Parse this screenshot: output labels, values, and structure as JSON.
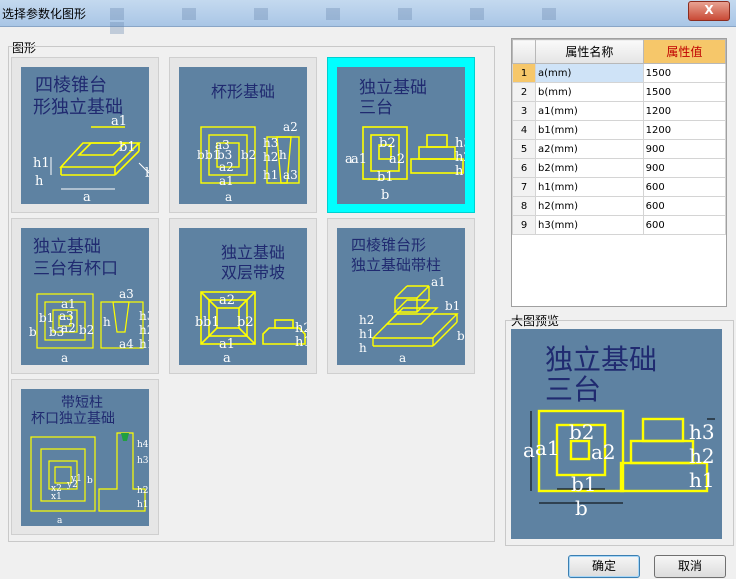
{
  "window": {
    "title": "选择参数化图形",
    "close_label": "X"
  },
  "shapes_group": {
    "label": "图形",
    "tiles": [
      {
        "name": "四棱锥台形独立基础",
        "lines": [
          "四棱锥台",
          "形独立基础"
        ],
        "selected": false
      },
      {
        "name": "杯形基础",
        "lines": [
          "杯形基础"
        ],
        "selected": false
      },
      {
        "name": "独立基础三台",
        "lines": [
          "独立基础",
          "三台"
        ],
        "selected": true
      },
      {
        "name": "独立基础三台有杯口",
        "lines": [
          "独立基础",
          "三台有杯口"
        ],
        "selected": false
      },
      {
        "name": "独立基础双层带坡",
        "lines": [
          "独立基础",
          "双层带坡"
        ],
        "selected": false
      },
      {
        "name": "四棱锥台形独立基础带柱",
        "lines": [
          "四棱锥台形",
          "独立基础带柱"
        ],
        "selected": false
      },
      {
        "name": "带短柱杯口独立基础",
        "lines": [
          "带短柱",
          "杯口独立基础"
        ],
        "selected": false
      }
    ]
  },
  "properties": {
    "headers": {
      "row_num": "",
      "name": "属性名称",
      "value": "属性值"
    },
    "rows": [
      {
        "num": "1",
        "name": "a(mm)",
        "value": "1500",
        "selected": true
      },
      {
        "num": "2",
        "name": "b(mm)",
        "value": "1500"
      },
      {
        "num": "3",
        "name": "a1(mm)",
        "value": "1200"
      },
      {
        "num": "4",
        "name": "b1(mm)",
        "value": "1200"
      },
      {
        "num": "5",
        "name": "a2(mm)",
        "value": "900"
      },
      {
        "num": "6",
        "name": "b2(mm)",
        "value": "900"
      },
      {
        "num": "7",
        "name": "h1(mm)",
        "value": "600"
      },
      {
        "num": "8",
        "name": "h2(mm)",
        "value": "600"
      },
      {
        "num": "9",
        "name": "h3(mm)",
        "value": "600"
      }
    ]
  },
  "preview": {
    "label": "大图预览",
    "title_lines": [
      "独立基础",
      "三台"
    ],
    "dims": {
      "a": "a",
      "a1": "a1",
      "b": "b",
      "b1": "b1",
      "b2": "b2",
      "a2": "a2",
      "h1": "h1",
      "h2": "h2",
      "h3": "h3"
    }
  },
  "buttons": {
    "ok": "确定",
    "cancel": "取消"
  },
  "colors": {
    "thumb_bg": "#5e82a2",
    "drawing": "#ffff00",
    "title_text": "#202a70",
    "selected_border": "#00ffff"
  }
}
